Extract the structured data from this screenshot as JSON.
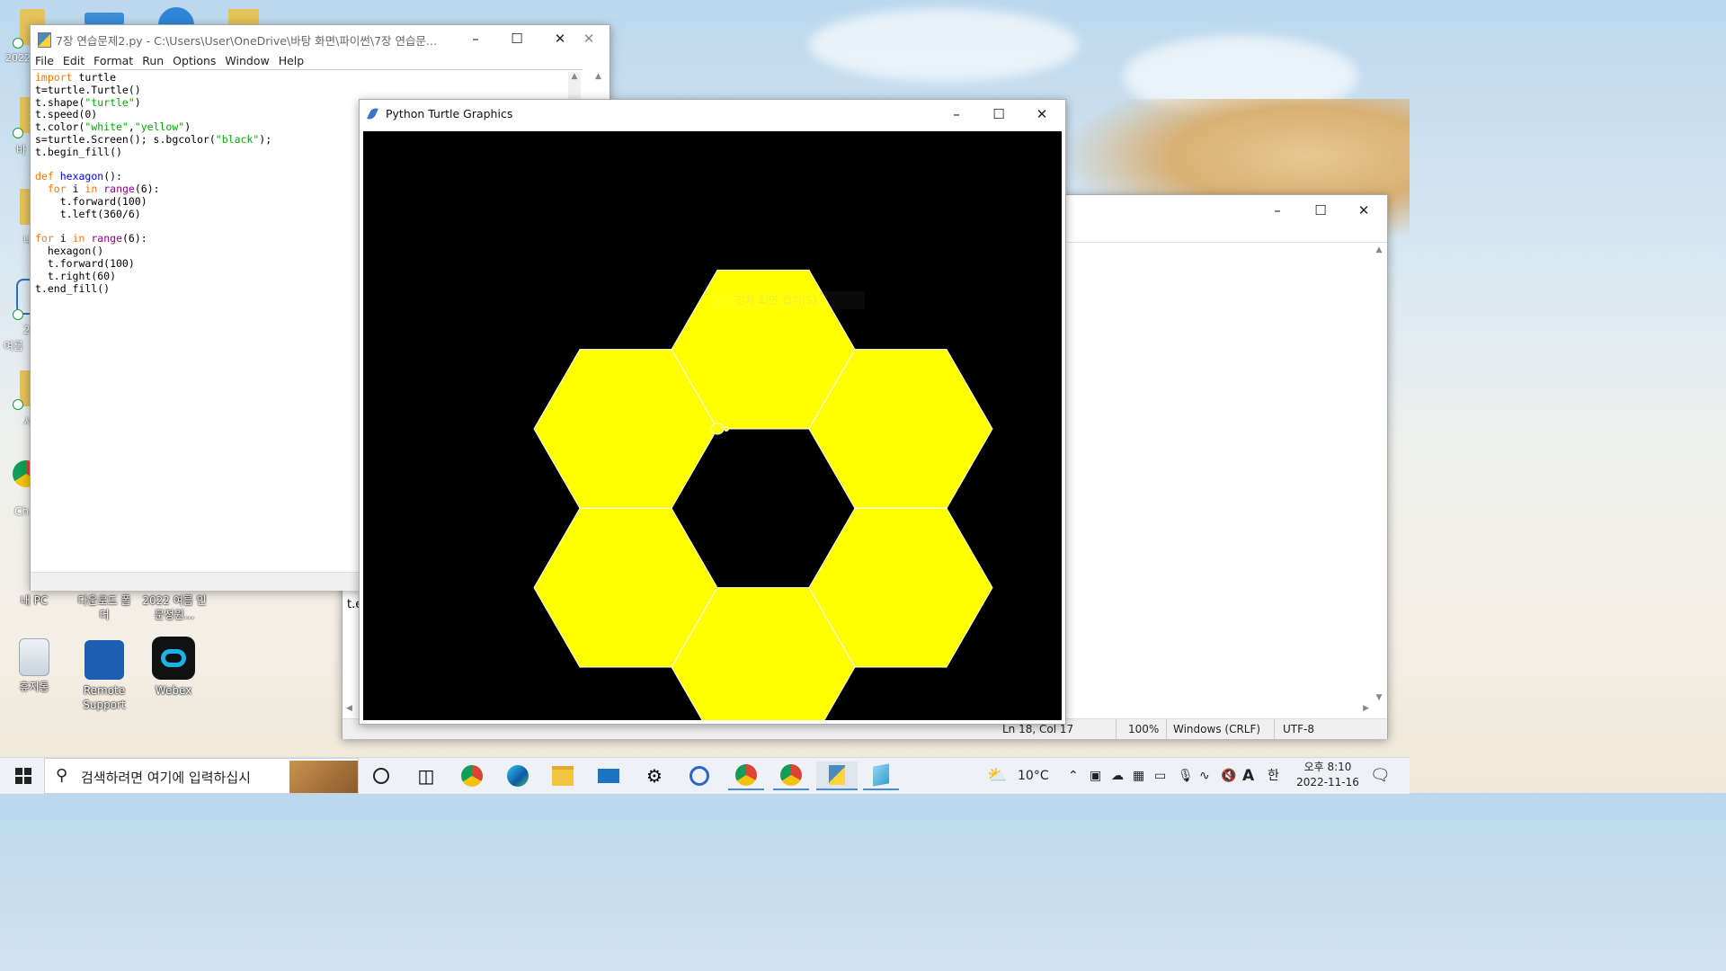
{
  "desktop": {
    "icons": [
      {
        "name": "내 PC"
      },
      {
        "name": "다운로드 폴더"
      },
      {
        "name": "2022 여름 인문정원..."
      },
      {
        "name": "휴지통"
      },
      {
        "name": "Remote Support"
      },
      {
        "name": "Webex"
      }
    ],
    "partial_labels": [
      "2022",
      "바",
      "내",
      "2",
      "여름",
      "사",
      "Ch"
    ]
  },
  "editor": {
    "title": "7장 연습문제2.py - C:\\Users\\User\\OneDrive\\바탕 화면\\파이썬\\7장 연습문...",
    "menu": [
      "File",
      "Edit",
      "Format",
      "Run",
      "Options",
      "Window",
      "Help"
    ],
    "code_lines": [
      [
        {
          "t": "import",
          "c": "kw"
        },
        {
          "t": " turtle",
          "c": ""
        }
      ],
      [
        {
          "t": "t=turtle.Turtle()",
          "c": ""
        }
      ],
      [
        {
          "t": "t.shape(",
          "c": ""
        },
        {
          "t": "\"turtle\"",
          "c": "st"
        },
        {
          "t": ")",
          "c": ""
        }
      ],
      [
        {
          "t": "t.speed(0)",
          "c": ""
        }
      ],
      [
        {
          "t": "t.color(",
          "c": ""
        },
        {
          "t": "\"white\"",
          "c": "st"
        },
        {
          "t": ",",
          "c": ""
        },
        {
          "t": "\"yellow\"",
          "c": "st"
        },
        {
          "t": ")",
          "c": ""
        }
      ],
      [
        {
          "t": "s=turtle.Screen(); s.bgcolor(",
          "c": ""
        },
        {
          "t": "\"black\"",
          "c": "st"
        },
        {
          "t": ");",
          "c": ""
        }
      ],
      [
        {
          "t": "t.begin_fill()",
          "c": ""
        }
      ],
      [
        {
          "t": "",
          "c": ""
        }
      ],
      [
        {
          "t": "def",
          "c": "kw"
        },
        {
          "t": " ",
          "c": ""
        },
        {
          "t": "hexagon",
          "c": "df"
        },
        {
          "t": "():",
          "c": ""
        }
      ],
      [
        {
          "t": "  ",
          "c": ""
        },
        {
          "t": "for",
          "c": "kw"
        },
        {
          "t": " i ",
          "c": ""
        },
        {
          "t": "in",
          "c": "kw"
        },
        {
          "t": " ",
          "c": ""
        },
        {
          "t": "range",
          "c": "bi"
        },
        {
          "t": "(6):",
          "c": ""
        }
      ],
      [
        {
          "t": "    t.forward(100)",
          "c": ""
        }
      ],
      [
        {
          "t": "    t.left(360/6)",
          "c": ""
        }
      ],
      [
        {
          "t": "",
          "c": ""
        }
      ],
      [
        {
          "t": "for",
          "c": "kw"
        },
        {
          "t": " i ",
          "c": ""
        },
        {
          "t": "in",
          "c": "kw"
        },
        {
          "t": " ",
          "c": ""
        },
        {
          "t": "range",
          "c": "bi"
        },
        {
          "t": "(6):",
          "c": ""
        }
      ],
      [
        {
          "t": "  hexagon()",
          "c": ""
        }
      ],
      [
        {
          "t": "  t.forward(100)",
          "c": ""
        }
      ],
      [
        {
          "t": "  t.right(60)",
          "c": ""
        }
      ],
      [
        {
          "t": "t.end_fill()",
          "c": ""
        }
      ]
    ]
  },
  "turtle_window": {
    "title": "Python Turtle Graphics",
    "overlay_text": "전체 화면 캡처(S)",
    "bg_color": "#000000",
    "fill_color": "#ffff00",
    "pen_color": "#ffffff"
  },
  "back_window": {
    "partial_text": "t.e",
    "status": {
      "position": "Ln 18, Col 17",
      "zoom": "100%",
      "line_ending": "Windows (CRLF)",
      "encoding": "UTF-8"
    }
  },
  "taskbar": {
    "search_placeholder": "검색하려면 여기에 입력하십시",
    "weather": "10°C",
    "ime": "한",
    "font_glyph": "A",
    "time": "오후 8:10",
    "date": "2022-11-16"
  }
}
